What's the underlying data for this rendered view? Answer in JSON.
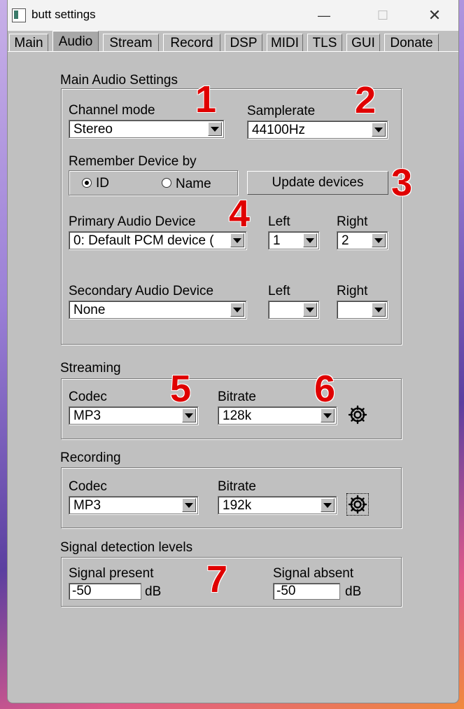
{
  "window": {
    "title": "butt settings"
  },
  "tabs": [
    "Main",
    "Audio",
    "Stream",
    "Record",
    "DSP",
    "MIDI",
    "TLS",
    "GUI",
    "Donate"
  ],
  "main_audio": {
    "group_label": "Main Audio Settings",
    "channel_mode_label": "Channel mode",
    "channel_mode_value": "Stereo",
    "samplerate_label": "Samplerate",
    "samplerate_value": "44100Hz",
    "remember_label": "Remember Device by",
    "radio_id_label": "ID",
    "radio_name_label": "Name",
    "update_button": "Update devices",
    "primary_label": "Primary Audio Device",
    "primary_value": "0: Default PCM device (",
    "left_label": "Left",
    "right_label": "Right",
    "primary_left": "1",
    "primary_right": "2",
    "secondary_label": "Secondary Audio Device",
    "secondary_value": "None",
    "secondary_left": "",
    "secondary_right": ""
  },
  "streaming": {
    "group_label": "Streaming",
    "codec_label": "Codec",
    "codec_value": "MP3",
    "bitrate_label": "Bitrate",
    "bitrate_value": "128k"
  },
  "recording": {
    "group_label": "Recording",
    "codec_label": "Codec",
    "codec_value": "MP3",
    "bitrate_label": "Bitrate",
    "bitrate_value": "192k"
  },
  "signal": {
    "group_label": "Signal detection levels",
    "present_label": "Signal present",
    "present_value": "-50",
    "absent_label": "Signal absent",
    "absent_value": "-50",
    "unit": "dB"
  },
  "annotations": [
    "1",
    "2",
    "3",
    "4",
    "5",
    "6",
    "7"
  ],
  "icons": {
    "settings": "gear-icon"
  }
}
